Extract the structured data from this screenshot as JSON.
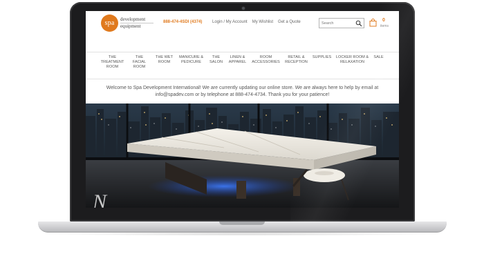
{
  "header": {
    "logo": {
      "badge": "spa",
      "line1": "development",
      "line2": "equipment"
    },
    "phone": "888-474-4SDI (4374)",
    "links": [
      "Login / My Account",
      "My Wishlist",
      "Get a Quote"
    ],
    "search_placeholder": "Search",
    "cart": {
      "count": "0",
      "label": "items"
    }
  },
  "nav": {
    "items": [
      "THE TREATMENT ROOM",
      "THE FACIAL ROOM",
      "THE WET ROOM",
      "MANICURE & PEDICURE",
      "THE SALON",
      "LINEN & APPAREL",
      "ROOM ACCESSORIES",
      "RETAIL & RECEPTION",
      "SUPPLIES",
      "LOCKER ROOM & RELAXATION",
      "SALE"
    ]
  },
  "welcome": {
    "message": "Welcome to Spa Development International! We are currently updating our online store. We are always here to help by email at info@spadev.com or by telephone at 888-474-4734. Thank you for your patience!"
  },
  "hero": {
    "caption": "N"
  },
  "colors": {
    "accent": "#e07a1e",
    "laptop_bezel": "#1c1c1e",
    "laptop_base": "#d6d6d8"
  }
}
